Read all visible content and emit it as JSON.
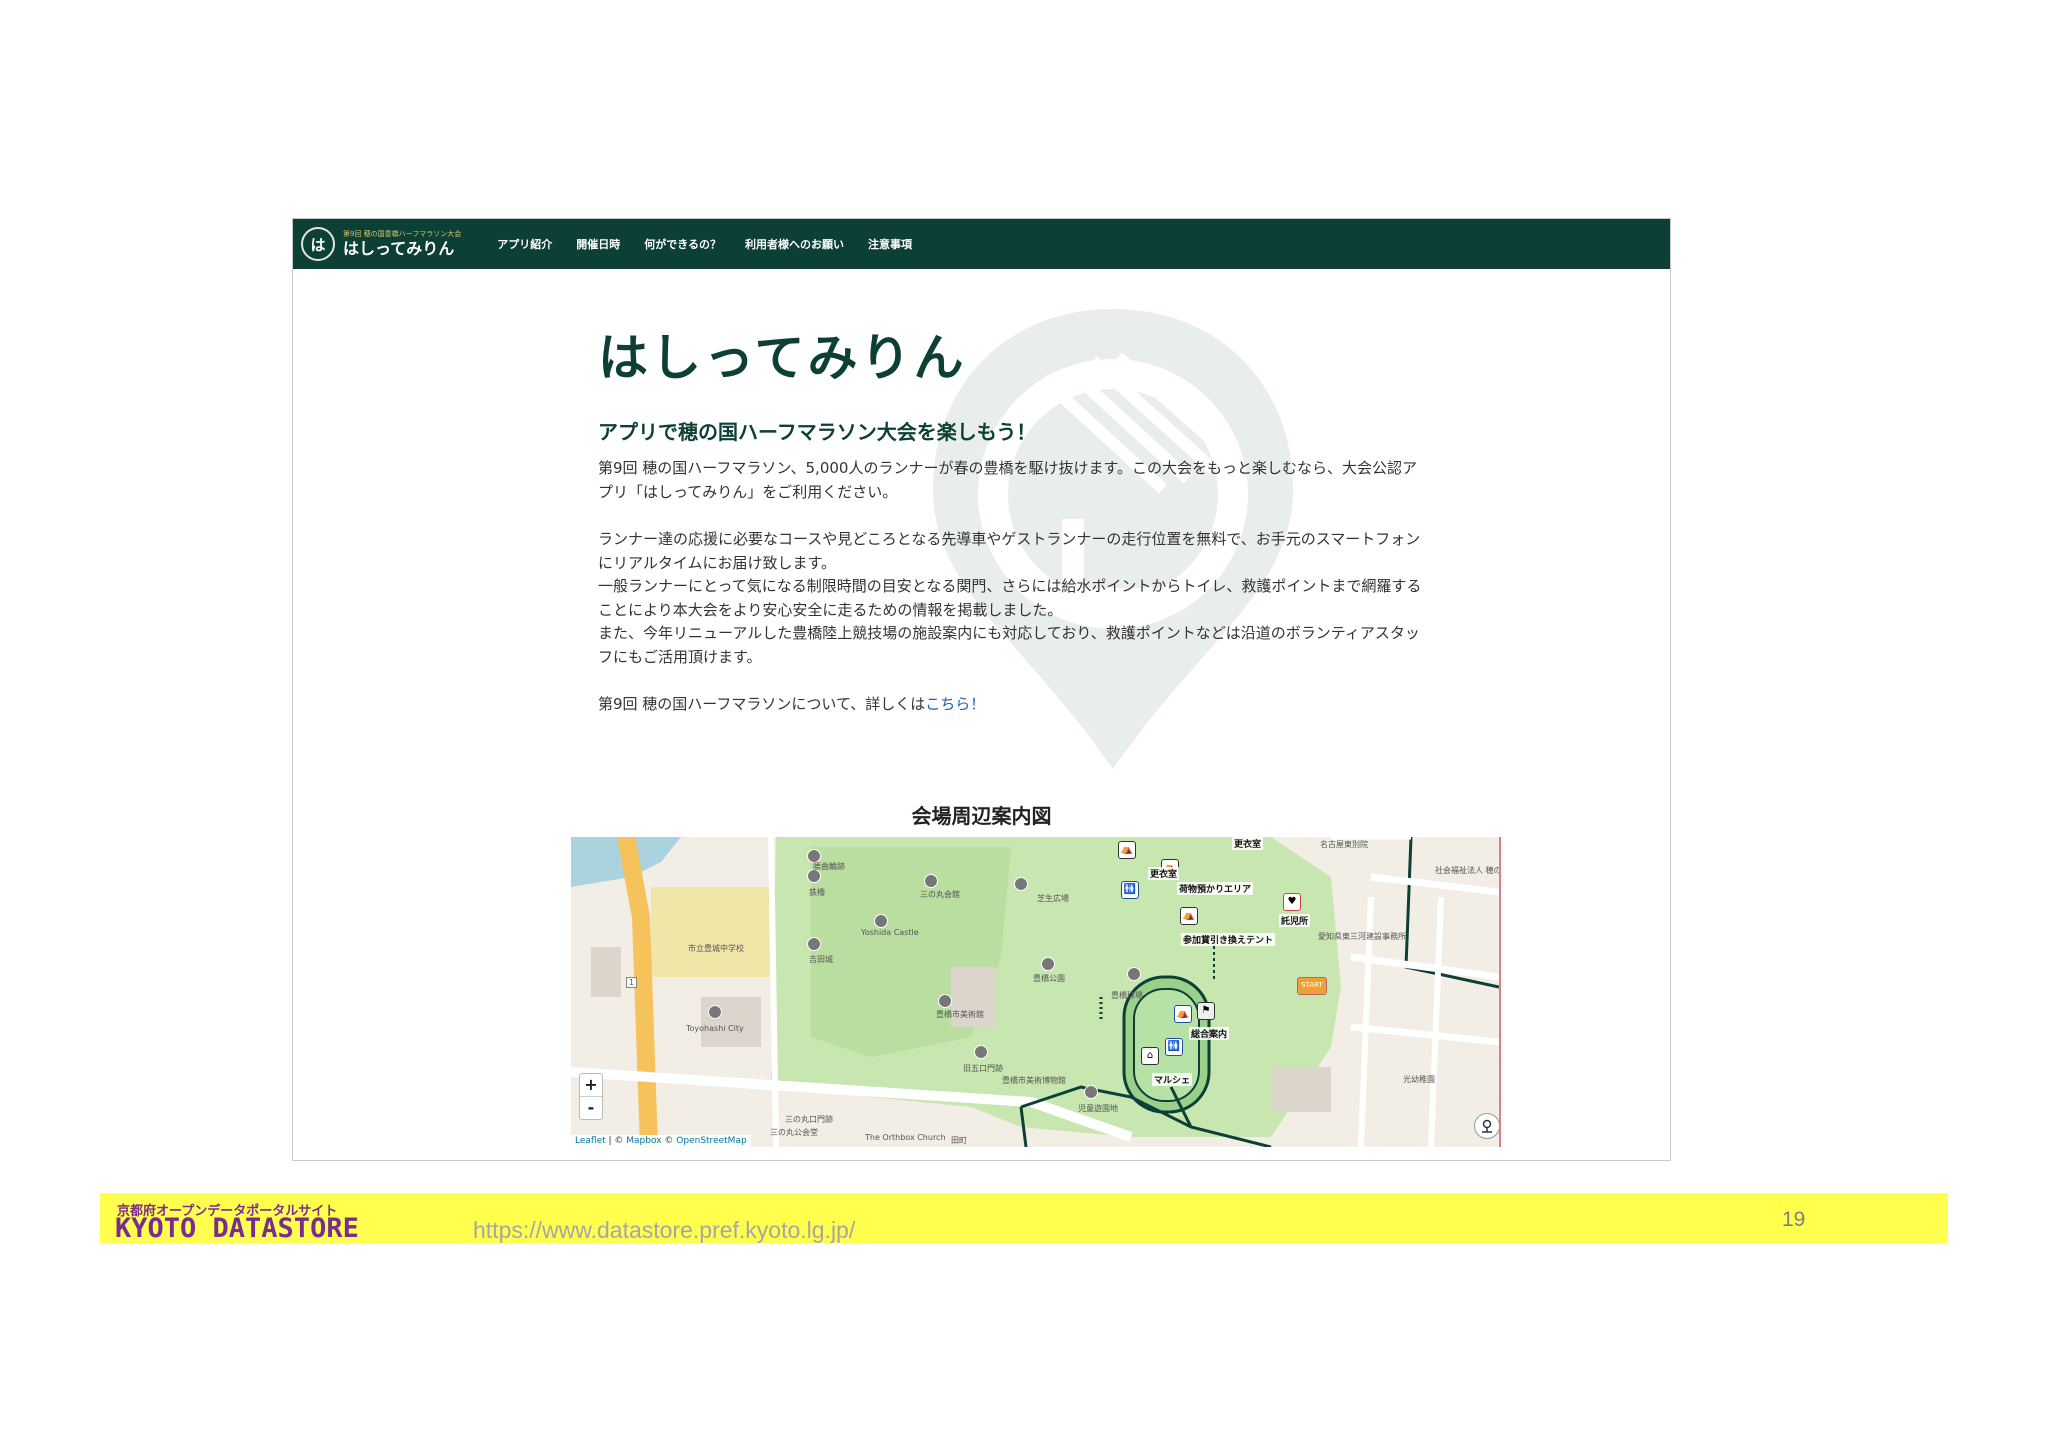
{
  "navbar": {
    "brand_tag": "第9回 穂の国豊橋ハーフマラソン大会",
    "brand_name": "はしってみりん",
    "brand_mark": "は",
    "items": [
      {
        "label": "アプリ紹介"
      },
      {
        "label": "開催日時"
      },
      {
        "label": "何ができるの？"
      },
      {
        "label": "利用者様へのお願い"
      },
      {
        "label": "注意事項"
      }
    ]
  },
  "hero": {
    "title": "はしってみりん",
    "subtitle": "アプリで穂の国ハーフマラソン大会を楽しもう！",
    "paragraph1": "第9回 穂の国ハーフマラソン、5,000人のランナーが春の豊橋を駆け抜けます。この大会をもっと楽しむなら、大会公認アプリ「はしってみりん」をご利用ください。",
    "paragraph2_lines": [
      "ランナー達の応援に必要なコースや見どころとなる先導車やゲストランナーの走行位置を無料で、お手元のスマートフォンにリアルタイムにお届け致します。",
      "一般ランナーにとって気になる制限時間の目安となる関門、さらには給水ポイントからトイレ、救護ポイントまで網羅することにより本大会をより安心安全に走るための情報を掲載しました。",
      "また、今年リニューアルした豊橋陸上競技場の施設案内にも対応しており、救護ポイントなどは沿道のボランティアスタッフにもご活用頂けます。"
    ],
    "more_prefix": "第9回 穂の国ハーフマラソンについて、詳しくは",
    "more_link": "こちら！"
  },
  "map": {
    "title": "会場周辺案内図",
    "zoom_in": "+",
    "zoom_out": "-",
    "attribution": {
      "leaflet": "Leaflet",
      "sep": " | © ",
      "mapbox": "Mapbox",
      "sep2": " © ",
      "osm": "OpenStreetMap"
    },
    "labels": {
      "kouiseki": "更衣室",
      "kouiseki2": "更衣室",
      "nimotsu": "荷物預かりエリア",
      "takujisho": "託児所",
      "tent": "参加賞引き換えテント",
      "sougou": "総合案内",
      "marche": "マルシェ",
      "start": "START"
    },
    "places": {
      "ishikura": "腰曲輪跡",
      "tetsuwa": "鉄櫓",
      "sannomaru": "三の丸会館",
      "shibafu": "芝生広場",
      "yoshida_castle": "Yoshida Castle",
      "yoshida_jp": "吉田城",
      "school": "市立豊城中学校",
      "park": "豊橋公園",
      "baseball": "豊橋球場",
      "museum": "豊橋市美術館",
      "city": "Toyohashi City",
      "gate": "旧五口門跡",
      "sannomon": "三の丸口門跡",
      "sannomaru2": "三の丸公会堂",
      "orthodox": "The Orthbox Church",
      "tamachi": "田町",
      "jidou": "児童遊園地",
      "museum2": "豊橋市美術博物館",
      "nagoya": "名古屋東別院",
      "kouen": "光幼稚園",
      "shakai": "社会福祉法人 穂の国保育",
      "aichi": "愛知県東三河建設事務所",
      "route": "1"
    }
  },
  "footer": {
    "small": "京都府オープンデータポータルサイト",
    "logo": "KYOTO DATASTORE",
    "url": "https://www.datastore.pref.kyoto.lg.jp/",
    "page": "19"
  },
  "colors": {
    "nav_bg": "#0c3f36",
    "accent": "#0c3f36",
    "link": "#1f5fbf",
    "footer_bar": "#ffff4d",
    "footer_logo": "#7b2c8f"
  },
  "icons": [
    "brand-logo-icon",
    "watermark-pin-icon",
    "locate-icon",
    "poi-icon",
    "toilet-icon",
    "tent-icon",
    "start-flag-icon"
  ]
}
